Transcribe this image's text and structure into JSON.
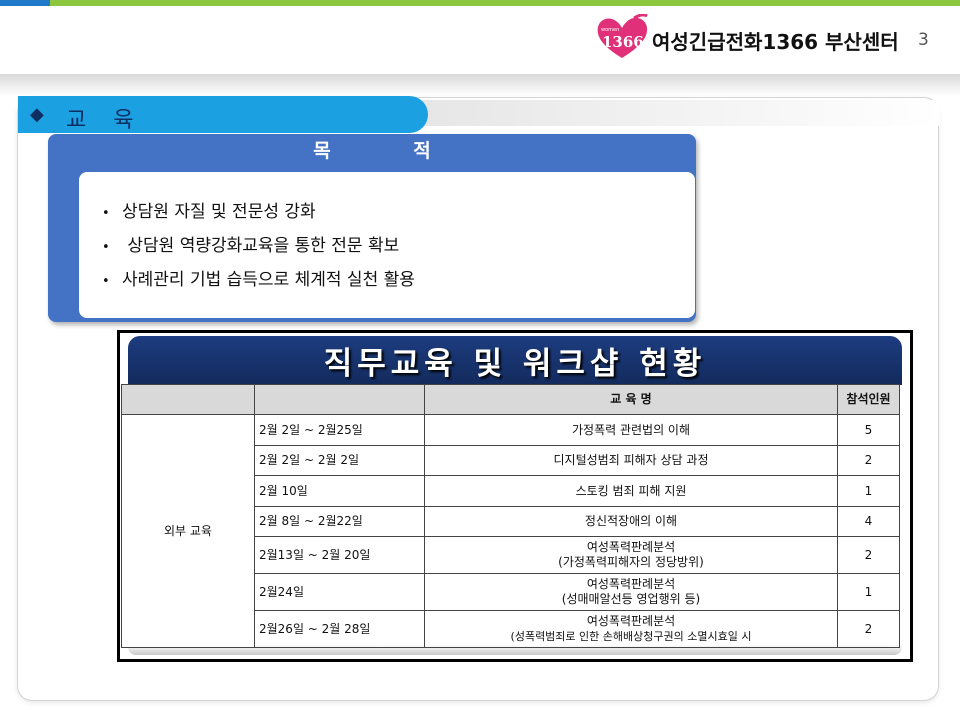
{
  "header": {
    "org_name": "여성긴급전화1366 부산센터",
    "page_number": "3",
    "logo_text": "1366",
    "logo_small_text": "women"
  },
  "section": {
    "title": "교 육",
    "bullet_symbol": "◆"
  },
  "purpose": {
    "title": "목 적",
    "items": [
      "상담원 자질 및 전문성 강화",
      " 상담원 역량강화교육을 통한 전문 확보",
      "사례관리 기법 습득으로 체계적 실천 활용"
    ]
  },
  "table": {
    "banner_title": "직무교육 및 워크샵 현황",
    "headers": [
      "",
      "",
      "교 육 명",
      "참석인원"
    ],
    "category": "외부 교육",
    "rows": [
      {
        "date": "2월 2일 ~ 2월25일",
        "name": [
          "가정폭력 관련법의 이해"
        ],
        "count": "5"
      },
      {
        "date": "2월 2일 ~ 2월 2일",
        "name": [
          "디지털성범죄 피해자 상담 과정"
        ],
        "count": "2"
      },
      {
        "date": "2월 10일",
        "name": [
          "스토킹 범죄 피해 지원"
        ],
        "count": "1"
      },
      {
        "date": "2월 8일 ~ 2월22일",
        "name": [
          "정신적장애의 이해"
        ],
        "count": "4"
      },
      {
        "date": "2월13일 ~ 2월 20일",
        "name": [
          "여성폭력판례분석",
          "(가정폭력피해자의 정당방위)"
        ],
        "count": "2"
      },
      {
        "date": "2월24일",
        "name": [
          "여성폭력판례분석",
          "(성매매알선등 영업행위 등)"
        ],
        "count": "1"
      },
      {
        "date": "2월26일 ~ 2월 28일",
        "name": [
          "여성폭력판례분석",
          "(성폭력범죄로 인한 손해배상청구권의 소멸시효일 시"
        ],
        "count": "2"
      }
    ]
  },
  "colors": {
    "top_bar": "#8dc63f",
    "section_head": "#1ba1e2",
    "purpose_box": "#4472c4",
    "banner": "#1d3d80",
    "logo": "#e0307a"
  },
  "icons": {
    "logo": "heart-logo-icon"
  }
}
